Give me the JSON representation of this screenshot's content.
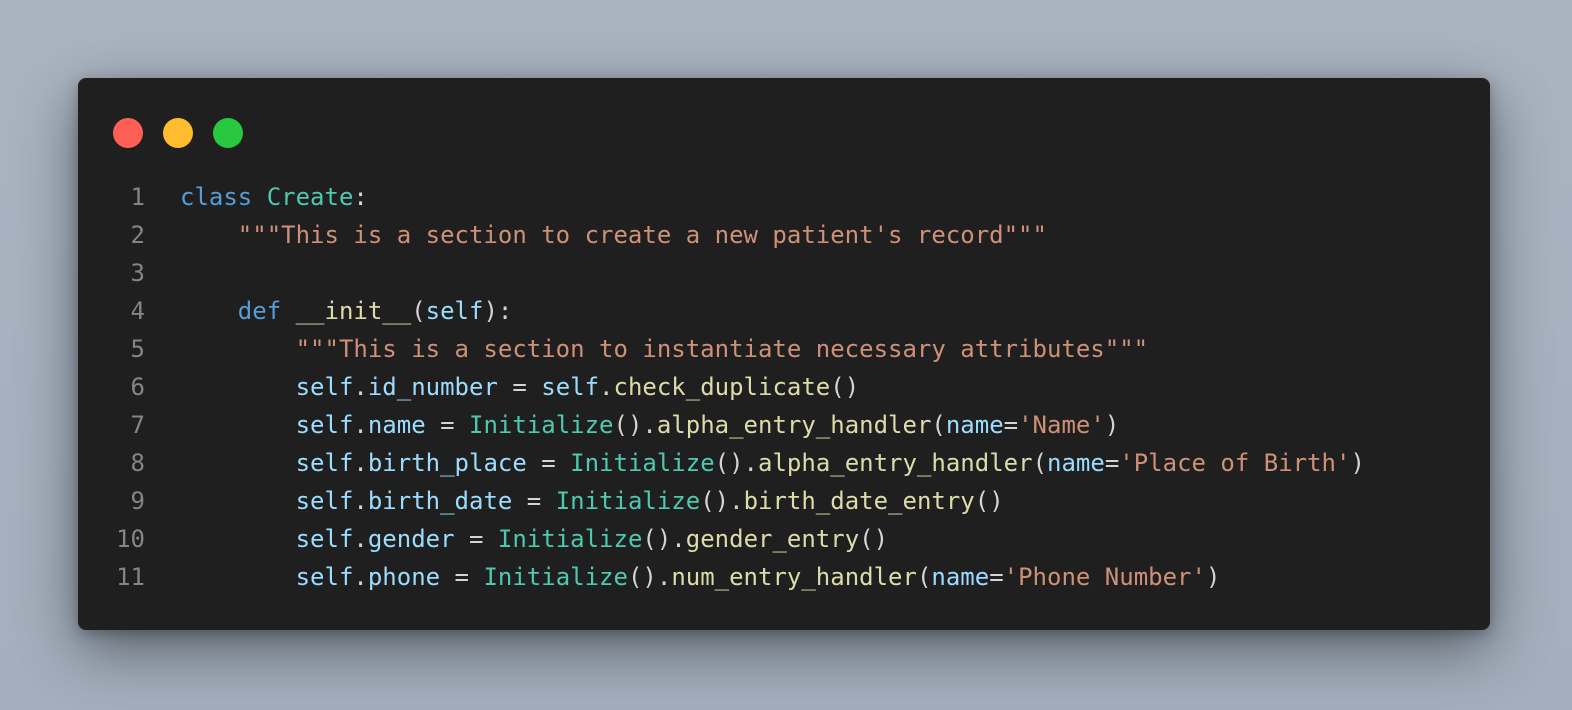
{
  "window": {
    "controls": [
      {
        "name": "close",
        "color": "#ff5f57"
      },
      {
        "name": "minimize",
        "color": "#febc2e"
      },
      {
        "name": "maximize",
        "color": "#28c840"
      }
    ]
  },
  "code": {
    "language": "python",
    "lines": [
      {
        "num": "1",
        "indent": "",
        "tokens": [
          {
            "t": "class",
            "c": "kw"
          },
          {
            "t": " ",
            "c": "pun"
          },
          {
            "t": "Create",
            "c": "cls"
          },
          {
            "t": ":",
            "c": "pun"
          }
        ]
      },
      {
        "num": "2",
        "indent": "    ",
        "tokens": [
          {
            "t": "\"\"\"This is a section to create a new patient's record\"\"\"",
            "c": "str"
          }
        ]
      },
      {
        "num": "3",
        "indent": "",
        "tokens": []
      },
      {
        "num": "4",
        "indent": "    ",
        "tokens": [
          {
            "t": "def",
            "c": "kw"
          },
          {
            "t": " ",
            "c": "pun"
          },
          {
            "t": "__init__",
            "c": "fn"
          },
          {
            "t": "(",
            "c": "pun"
          },
          {
            "t": "self",
            "c": "var"
          },
          {
            "t": "):",
            "c": "pun"
          }
        ]
      },
      {
        "num": "5",
        "indent": "        ",
        "tokens": [
          {
            "t": "\"\"\"This is a section to instantiate necessary attributes\"\"\"",
            "c": "str"
          }
        ]
      },
      {
        "num": "6",
        "indent": "        ",
        "tokens": [
          {
            "t": "self",
            "c": "var"
          },
          {
            "t": ".",
            "c": "pun"
          },
          {
            "t": "id_number",
            "c": "var"
          },
          {
            "t": " = ",
            "c": "pun"
          },
          {
            "t": "self",
            "c": "var"
          },
          {
            "t": ".",
            "c": "pun"
          },
          {
            "t": "check_duplicate",
            "c": "fn"
          },
          {
            "t": "()",
            "c": "pun"
          }
        ]
      },
      {
        "num": "7",
        "indent": "        ",
        "tokens": [
          {
            "t": "self",
            "c": "var"
          },
          {
            "t": ".",
            "c": "pun"
          },
          {
            "t": "name",
            "c": "var"
          },
          {
            "t": " = ",
            "c": "pun"
          },
          {
            "t": "Initialize",
            "c": "cls"
          },
          {
            "t": "().",
            "c": "pun"
          },
          {
            "t": "alpha_entry_handler",
            "c": "fn"
          },
          {
            "t": "(",
            "c": "pun"
          },
          {
            "t": "name",
            "c": "var"
          },
          {
            "t": "=",
            "c": "pun"
          },
          {
            "t": "'Name'",
            "c": "str"
          },
          {
            "t": ")",
            "c": "pun"
          }
        ]
      },
      {
        "num": "8",
        "indent": "        ",
        "tokens": [
          {
            "t": "self",
            "c": "var"
          },
          {
            "t": ".",
            "c": "pun"
          },
          {
            "t": "birth_place",
            "c": "var"
          },
          {
            "t": " = ",
            "c": "pun"
          },
          {
            "t": "Initialize",
            "c": "cls"
          },
          {
            "t": "().",
            "c": "pun"
          },
          {
            "t": "alpha_entry_handler",
            "c": "fn"
          },
          {
            "t": "(",
            "c": "pun"
          },
          {
            "t": "name",
            "c": "var"
          },
          {
            "t": "=",
            "c": "pun"
          },
          {
            "t": "'Place of Birth'",
            "c": "str"
          },
          {
            "t": ")",
            "c": "pun"
          }
        ]
      },
      {
        "num": "9",
        "indent": "        ",
        "tokens": [
          {
            "t": "self",
            "c": "var"
          },
          {
            "t": ".",
            "c": "pun"
          },
          {
            "t": "birth_date",
            "c": "var"
          },
          {
            "t": " = ",
            "c": "pun"
          },
          {
            "t": "Initialize",
            "c": "cls"
          },
          {
            "t": "().",
            "c": "pun"
          },
          {
            "t": "birth_date_entry",
            "c": "fn"
          },
          {
            "t": "()",
            "c": "pun"
          }
        ]
      },
      {
        "num": "10",
        "indent": "        ",
        "tokens": [
          {
            "t": "self",
            "c": "var"
          },
          {
            "t": ".",
            "c": "pun"
          },
          {
            "t": "gender",
            "c": "var"
          },
          {
            "t": " = ",
            "c": "pun"
          },
          {
            "t": "Initialize",
            "c": "cls"
          },
          {
            "t": "().",
            "c": "pun"
          },
          {
            "t": "gender_entry",
            "c": "fn"
          },
          {
            "t": "()",
            "c": "pun"
          }
        ]
      },
      {
        "num": "11",
        "indent": "        ",
        "tokens": [
          {
            "t": "self",
            "c": "var"
          },
          {
            "t": ".",
            "c": "pun"
          },
          {
            "t": "phone",
            "c": "var"
          },
          {
            "t": " = ",
            "c": "pun"
          },
          {
            "t": "Initialize",
            "c": "cls"
          },
          {
            "t": "().",
            "c": "pun"
          },
          {
            "t": "num_entry_handler",
            "c": "fn"
          },
          {
            "t": "(",
            "c": "pun"
          },
          {
            "t": "name",
            "c": "var"
          },
          {
            "t": "=",
            "c": "pun"
          },
          {
            "t": "'Phone Number'",
            "c": "str"
          },
          {
            "t": ")",
            "c": "pun"
          }
        ]
      }
    ]
  }
}
